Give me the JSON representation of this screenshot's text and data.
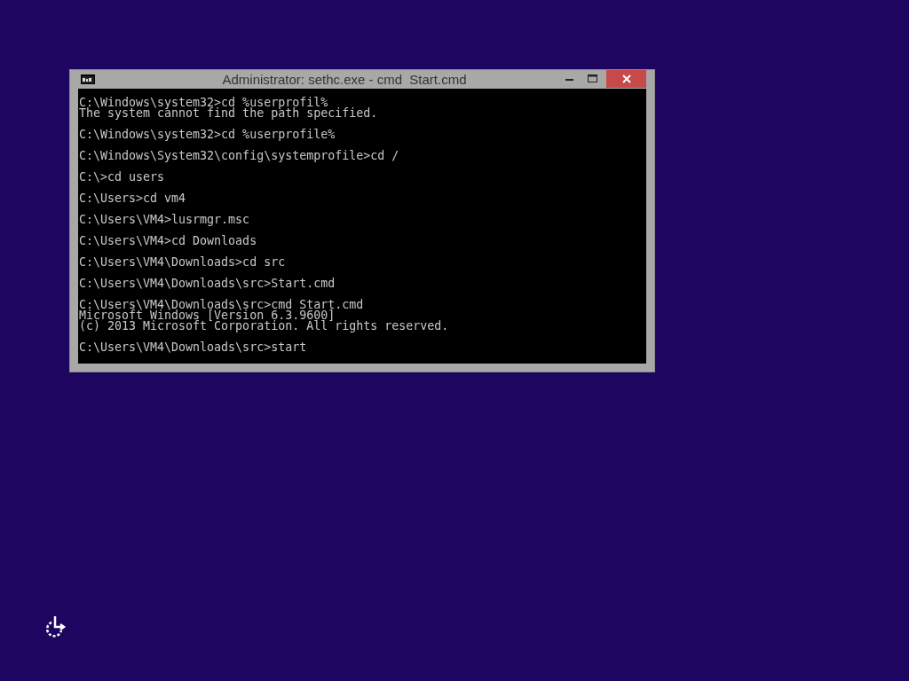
{
  "window": {
    "title": "Administrator: sethc.exe - cmd  Start.cmd"
  },
  "console": {
    "blocks": [
      [
        "C:\\Windows\\system32>cd %userprofil%",
        "The system cannot find the path specified."
      ],
      [
        "C:\\Windows\\system32>cd %userprofile%"
      ],
      [
        "C:\\Windows\\System32\\config\\systemprofile>cd /"
      ],
      [
        "C:\\>cd users"
      ],
      [
        "C:\\Users>cd vm4"
      ],
      [
        "C:\\Users\\VM4>lusrmgr.msc"
      ],
      [
        "C:\\Users\\VM4>cd Downloads"
      ],
      [
        "C:\\Users\\VM4\\Downloads>cd src"
      ],
      [
        "C:\\Users\\VM4\\Downloads\\src>Start.cmd"
      ],
      [
        "C:\\Users\\VM4\\Downloads\\src>cmd Start.cmd",
        "Microsoft Windows [Version 6.3.9600]",
        "(c) 2013 Microsoft Corporation. All rights reserved."
      ],
      [
        "C:\\Users\\VM4\\Downloads\\src>start"
      ]
    ]
  }
}
